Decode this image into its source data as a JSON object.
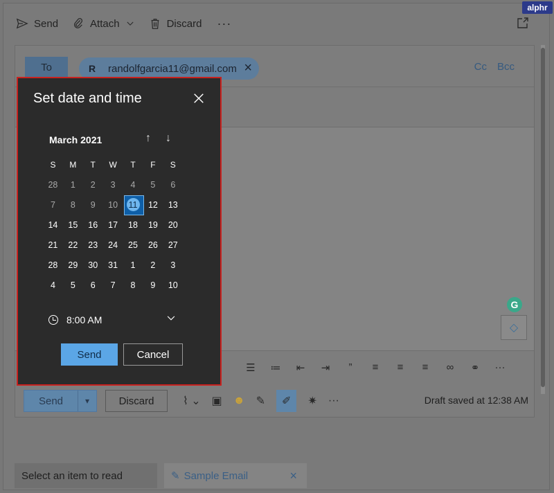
{
  "brand": {
    "logo_text": "alphr"
  },
  "toolbar": {
    "send_label": "Send",
    "attach_label": "Attach",
    "discard_label": "Discard",
    "more_label": "···"
  },
  "compose": {
    "to_label": "To",
    "recipient_initial": "R",
    "recipient_email": "randolfgarcia11@gmail.com",
    "recipient_remove": "×",
    "cc_label": "Cc",
    "bcc_label": "Bcc"
  },
  "format_icons": [
    "bullets-icon",
    "numbering-icon",
    "decrease-indent-icon",
    "increase-indent-icon",
    "quote-icon",
    "align-left-icon",
    "align-center-icon",
    "align-right-icon",
    "link-icon",
    "unlink-icon",
    "more-icon"
  ],
  "format_more": "···",
  "quote_glyph": "”",
  "bottom_bar": {
    "send_label": "Send",
    "discard_label": "Discard",
    "more_label": "···",
    "draft_status": "Draft saved at 12:38 AM"
  },
  "grammarly": {
    "badge_letter": "G"
  },
  "bottom_tabs": {
    "read_label": "Select an item to read",
    "email_label": "Sample Email",
    "email_close": "×"
  },
  "dialog": {
    "title": "Set date and time",
    "month_label": "March 2021",
    "weekdays": [
      "S",
      "M",
      "T",
      "W",
      "T",
      "F",
      "S"
    ],
    "weeks": [
      [
        "28",
        "1",
        "2",
        "3",
        "4",
        "5",
        "6"
      ],
      [
        "7",
        "8",
        "9",
        "10",
        "11",
        "12",
        "13"
      ],
      [
        "14",
        "15",
        "16",
        "17",
        "18",
        "19",
        "20"
      ],
      [
        "21",
        "22",
        "23",
        "24",
        "25",
        "26",
        "27"
      ],
      [
        "28",
        "29",
        "30",
        "31",
        "1",
        "2",
        "3"
      ],
      [
        "4",
        "5",
        "6",
        "7",
        "8",
        "9",
        "10"
      ]
    ],
    "selected_day": "11",
    "time_value": "8:00 AM",
    "send_label": "Send",
    "cancel_label": "Cancel"
  },
  "colors": {
    "accent": "#5ba6e6",
    "highlight_border": "#c9211e",
    "dialog_bg": "#2b2b2b"
  }
}
